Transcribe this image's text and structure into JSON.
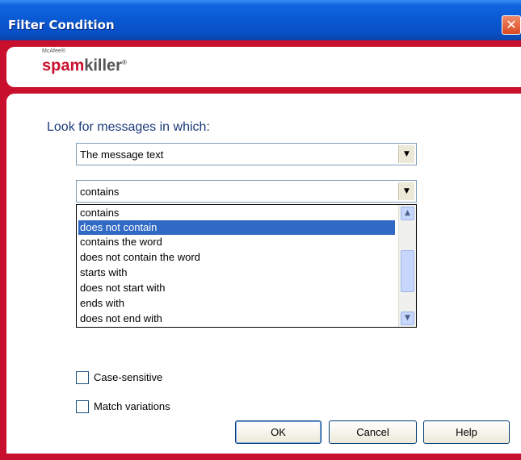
{
  "window": {
    "title": "Filter Condition",
    "close_glyph": "✕"
  },
  "branding": {
    "vendor": "McAfee®",
    "product_red": "spam",
    "product_grey": "killer",
    "product_mark": "®"
  },
  "form": {
    "prompt": "Look for messages in which:",
    "field_select": {
      "value": "The message text"
    },
    "operator_select": {
      "value": "contains",
      "options": [
        "contains",
        "does not contain",
        "contains the word",
        "does not contain the word",
        "starts with",
        "does not start with",
        "ends with",
        "does not end with"
      ],
      "highlighted_index": 1
    },
    "case_sensitive": {
      "label": "Case-sensitive",
      "checked": false
    },
    "match_variations": {
      "label": "Match variations",
      "checked": false
    }
  },
  "buttons": {
    "ok": "OK",
    "cancel": "Cancel",
    "help": "Help"
  },
  "icons": {
    "dropdown_arrow": "▼",
    "scroll_up": "▲",
    "scroll_down": "▼"
  },
  "colors": {
    "title_bar": "#0a5ad4",
    "brand_red": "#c8102e",
    "selection": "#316ac5"
  }
}
